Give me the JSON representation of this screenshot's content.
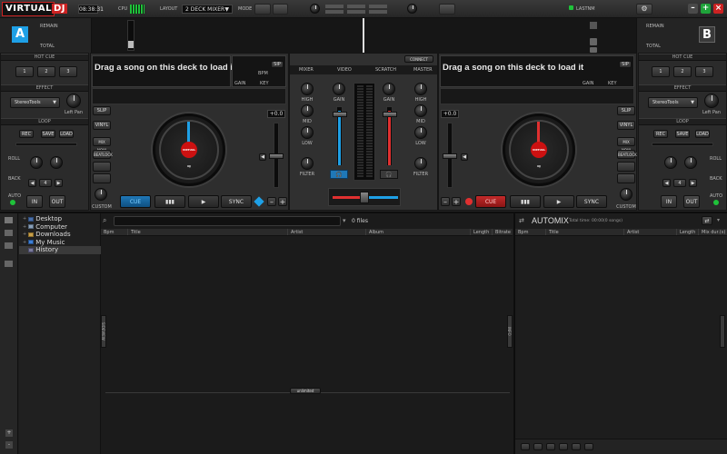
{
  "app": {
    "logo_prefix": "VIRTUAL",
    "logo_suffix": "DJ"
  },
  "topbar": {
    "clock": "08:38:31",
    "cpu_label": "CPU",
    "layout_label": "LAYOUT",
    "layout_value": "2 DECK MIXER",
    "mode_label": "MODE",
    "user_label": "LASTNM"
  },
  "deck_a": {
    "letter": "A",
    "remain_label": "REMAIN",
    "total_label": "TOTAL",
    "load_prompt": "Drag a song on this deck to load it",
    "bpm_label": "BPM",
    "gain_label": "GAIN",
    "key_label": "KEY",
    "sip_label": "SIP",
    "pitch_value": "+0.0",
    "hotcue_label": "HOT CUE",
    "hotcues": [
      "1",
      "2",
      "3"
    ],
    "effect_label": "EFFECT",
    "effect_value": "StereoTools",
    "effect_param": "Left Pan",
    "loop_label": "LOOP",
    "loop_buttons": [
      "REC",
      "SAVE",
      "LOAD"
    ],
    "roll_label": "ROLL",
    "back_label": "BACK",
    "auto_label": "AUTO",
    "loop_size": "4",
    "in_label": "IN",
    "out_label": "OUT",
    "slip_label": "SLIP",
    "vinyl_label": "VINYL",
    "mixnow_label": "MIX NOW",
    "beatlock_label": "BEATLOCK",
    "custom_label": "CUSTOM",
    "platter_label": "VIRTUAL DJ",
    "cue_label": "CUE",
    "sync_label": "SYNC"
  },
  "deck_b": {
    "letter": "B",
    "remain_label": "REMAIN",
    "total_label": "TOTAL",
    "load_prompt": "Drag a song on this deck to load it",
    "sip_label": "SIP",
    "gain_label": "GAIN",
    "key_label": "KEY",
    "pitch_value": "+0.0",
    "hotcue_label": "HOT CUE",
    "hotcues": [
      "1",
      "2",
      "3"
    ],
    "effect_label": "EFFECT",
    "effect_value": "StereoTools",
    "effect_param": "Left Pan",
    "loop_label": "LOOP",
    "loop_buttons": [
      "REC",
      "SAVE",
      "LOAD"
    ],
    "roll_label": "ROLL",
    "back_label": "BACK",
    "auto_label": "AUTO",
    "loop_size": "4",
    "in_label": "IN",
    "out_label": "OUT",
    "slip_label": "SLIP",
    "vinyl_label": "VINYL",
    "mixnow_label": "MIX NOW",
    "beatlock_label": "BEATLOCK",
    "custom_label": "CUSTOM",
    "platter_label": "VIRTUAL DJ",
    "cue_label": "CUE",
    "sync_label": "SYNC"
  },
  "mixer": {
    "tabs": [
      "MIXER",
      "VIDEO",
      "SCRATCH",
      "MASTER"
    ],
    "top_label": "CONNECT",
    "gain": "GAIN",
    "high": "HIGH",
    "mid": "MID",
    "low": "LOW",
    "filter": "FILTER"
  },
  "browser": {
    "search_placeholder": "",
    "file_count": "0 files",
    "folders": [
      "Desktop",
      "Computer",
      "Downloads",
      "My Music",
      "History"
    ],
    "columns": [
      "Bpm",
      "Title",
      "Artist",
      "Album",
      "Length",
      "Bitrate"
    ],
    "sideview_tab": "SIDEVIEW",
    "info_tab": "INFO",
    "status_label": "unlimited"
  },
  "automix": {
    "title": "AUTOMIX",
    "total_time": "Total time: 00:00(0 songs)",
    "columns": [
      "Bpm",
      "Title",
      "Artist",
      "Length",
      "Mix dur.(s)"
    ]
  },
  "colors": {
    "deck_a": "#1ea0e6",
    "deck_b": "#e03030",
    "accent_green": "#1fc23a"
  }
}
